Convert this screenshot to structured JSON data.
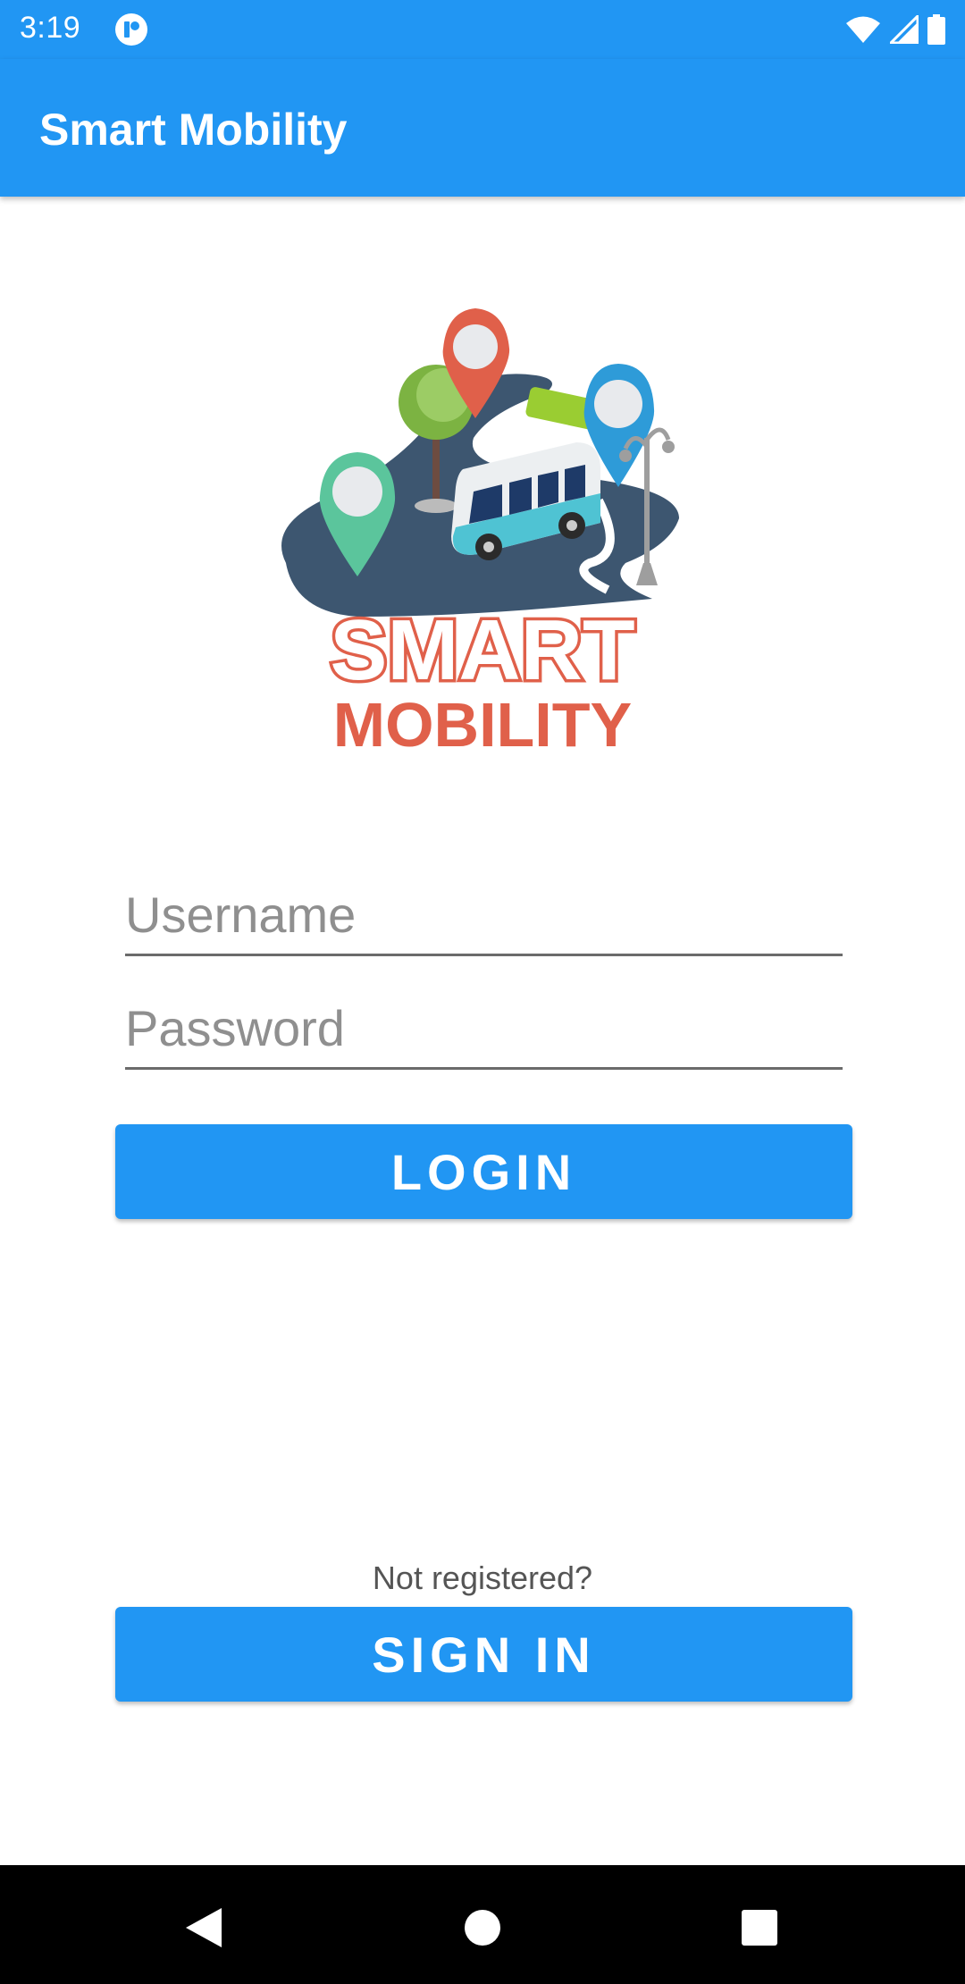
{
  "status_bar": {
    "time": "3:19"
  },
  "app_bar": {
    "title": "Smart Mobility"
  },
  "logo": {
    "line1": "SMART",
    "line2": "MOBILITY"
  },
  "form": {
    "username_placeholder": "Username",
    "password_placeholder": "Password",
    "login_label": "LOGIN"
  },
  "register": {
    "prompt": "Not registered?",
    "signin_label": "SIGN IN"
  },
  "colors": {
    "primary": "#2196f3",
    "logo_text": "#e0604a",
    "road": "#3d5670"
  },
  "icons": [
    "app-notification-icon",
    "wifi-icon",
    "signal-icon",
    "battery-icon",
    "back-icon",
    "home-icon",
    "recents-icon"
  ]
}
